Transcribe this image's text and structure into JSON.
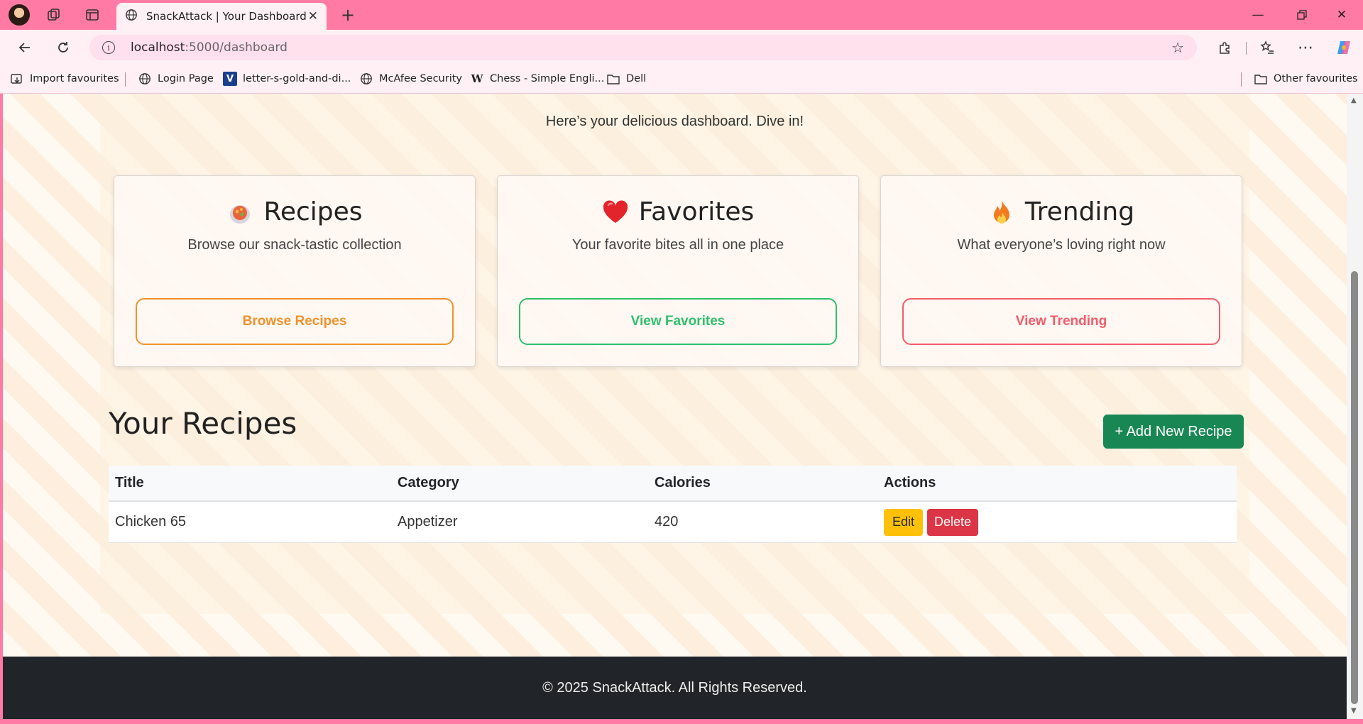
{
  "browser": {
    "tab_title": "SnackAttack | Your Dashboard",
    "url_host": "localhost",
    "url_path": ":5000/dashboard",
    "bookmarks": [
      {
        "label": "Import favourites",
        "icon": "import-icon"
      },
      {
        "label": "Login Page",
        "icon": "globe-icon"
      },
      {
        "label": "letter-s-gold-and-di...",
        "icon": "v-logo-icon"
      },
      {
        "label": "McAfee Security",
        "icon": "globe-icon"
      },
      {
        "label": "Chess - Simple Engli...",
        "icon": "wikipedia-icon"
      },
      {
        "label": "Dell",
        "icon": "folder-icon"
      }
    ],
    "other_favourites": "Other favourites"
  },
  "page": {
    "intro": "Here’s your delicious dashboard. Dive in!",
    "cards": [
      {
        "title": "Recipes",
        "subtitle": "Browse our snack-tastic collection",
        "button": "Browse Recipes",
        "color": "#f0922b",
        "icon": "stew-pot-icon"
      },
      {
        "title": "Favorites",
        "subtitle": "Your favorite bites all in one place",
        "button": "View Favorites",
        "color": "#2fc06c",
        "icon": "heart-icon"
      },
      {
        "title": "Trending",
        "subtitle": "What everyone’s loving right now",
        "button": "View Trending",
        "color": "#f25c6a",
        "icon": "fire-icon"
      }
    ],
    "section_title": "Your Recipes",
    "add_button": "+ Add New Recipe",
    "table": {
      "headers": [
        "Title",
        "Category",
        "Calories",
        "Actions"
      ],
      "rows": [
        {
          "title": "Chicken 65",
          "category": "Appetizer",
          "calories": "420",
          "edit": "Edit",
          "delete": "Delete"
        }
      ]
    },
    "footer": "© 2025 SnackAttack. All Rights Reserved."
  }
}
